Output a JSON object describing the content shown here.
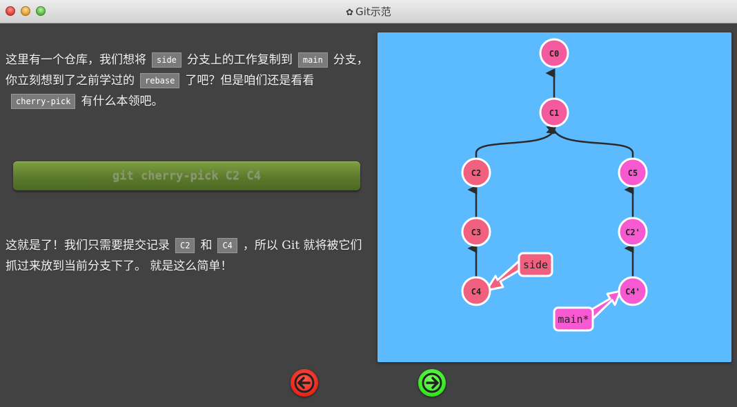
{
  "window": {
    "title": "Git示范",
    "title_icon": "gear-icon"
  },
  "instructions": {
    "p1_a": "这里有一个仓库，我们想将",
    "p1_code1": "side",
    "p1_b": "分支上的工作复制到",
    "p1_code2": "main",
    "p1_c": "分支，你立刻想到了之前学过的",
    "p1_code3": "rebase",
    "p1_d": "了吧？但是咱们还是看看",
    "p1_code4": "cherry-pick",
    "p1_e": "有什么本领吧。",
    "p2_a": "这就是了！我们只需要提交记录",
    "p2_code1": "C2",
    "p2_b": "和",
    "p2_code2": "C4",
    "p2_c": "，所以 Git 就将被它们抓过来放到当前分支下了。 就是这么简单！"
  },
  "command": {
    "label": "git cherry-pick C2 C4"
  },
  "graph": {
    "commits": {
      "c0": "C0",
      "c1": "C1",
      "c2": "C2",
      "c3": "C3",
      "c4": "C4",
      "c5": "C5",
      "c2p": "C2'",
      "c4p": "C4'"
    },
    "branches": {
      "side": "side",
      "main": "main*"
    },
    "colors": {
      "background": "#5cbaff",
      "commit_main_line": "#f45a9e",
      "commit_side_line": "#f2607f",
      "cherry_picked": "#f759d0",
      "edge": "#2b2b2b"
    }
  },
  "nav": {
    "back_icon": "arrow-left-icon",
    "forward_icon": "arrow-right-icon"
  }
}
